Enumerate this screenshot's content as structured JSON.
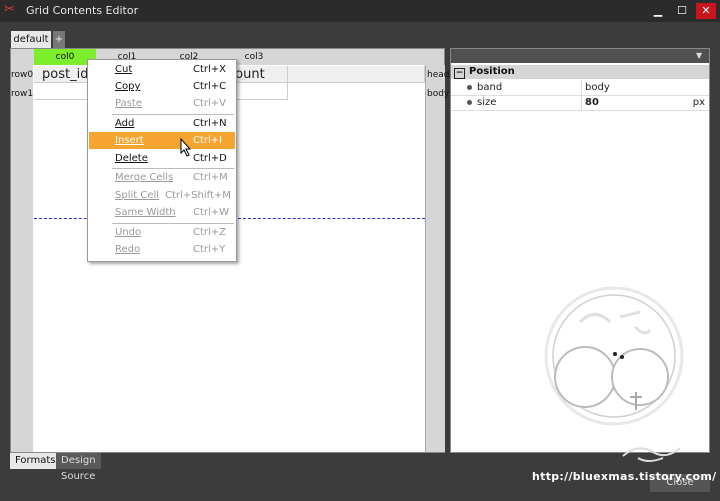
{
  "window": {
    "title": "Grid Contents Editor",
    "min_glyph": "▁",
    "max_glyph": "☐",
    "close_glyph": "✕"
  },
  "tabs": [
    {
      "label": "default"
    },
    {
      "label": "+"
    }
  ],
  "grid": {
    "columns": [
      "col0",
      "col1",
      "col2",
      "col3"
    ],
    "selected_column": "col0",
    "rows": [
      "row0",
      "row1"
    ],
    "bands": [
      "head",
      "body"
    ],
    "head_cells": [
      "post_id",
      "",
      "",
      "count"
    ]
  },
  "context_menu": {
    "items": [
      {
        "label": "Cut",
        "shortcut": "Ctrl+X",
        "enabled": true
      },
      {
        "label": "Copy",
        "shortcut": "Ctrl+C",
        "enabled": true
      },
      {
        "label": "Paste",
        "shortcut": "Ctrl+V",
        "enabled": false
      },
      {
        "label": "Add",
        "shortcut": "Ctrl+N",
        "enabled": true
      },
      {
        "label": "Insert",
        "shortcut": "Ctrl+I",
        "enabled": true,
        "highlighted": true
      },
      {
        "label": "Delete",
        "shortcut": "Ctrl+D",
        "enabled": true
      },
      {
        "label": "Merge Cells",
        "shortcut": "Ctrl+M",
        "enabled": false
      },
      {
        "label": "Split Cell",
        "shortcut": "Ctrl+Shift+M",
        "enabled": false
      },
      {
        "label": "Same Width",
        "shortcut": "Ctrl+W",
        "enabled": false
      },
      {
        "label": "Undo",
        "shortcut": "Ctrl+Z",
        "enabled": false
      },
      {
        "label": "Redo",
        "shortcut": "Ctrl+Y",
        "enabled": false
      }
    ]
  },
  "properties": {
    "dropdown_glyph": "▼",
    "section": "Position",
    "section_toggle": "−",
    "rows": [
      {
        "name": "band",
        "value": "body",
        "unit": ""
      },
      {
        "name": "size",
        "value": "80",
        "unit": "px"
      }
    ]
  },
  "bottom_tabs": [
    "Formats",
    "Design Source"
  ],
  "watermark_url": "http://bluexmas.tistory.com/",
  "close_button": "Close",
  "colors": {
    "highlight": "#f6a531",
    "selected_column": "#7cee2c",
    "close": "#c8141c"
  }
}
